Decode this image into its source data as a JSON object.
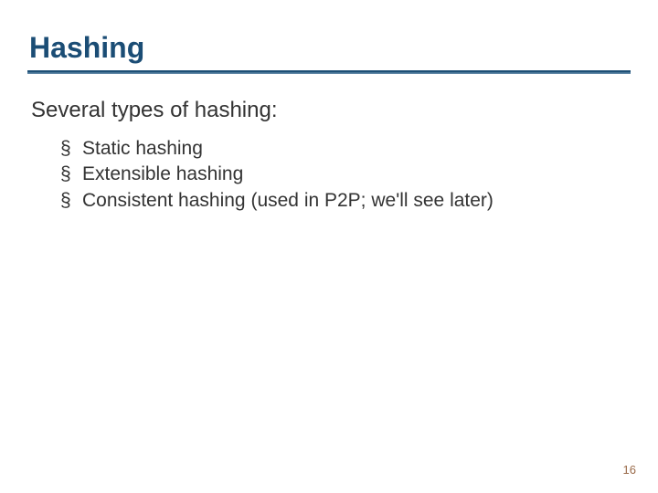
{
  "slide": {
    "title": "Hashing",
    "intro": "Several types of hashing:",
    "bullets": [
      "Static hashing",
      "Extensible hashing",
      "Consistent hashing (used in P2P; we'll see later)"
    ],
    "page_number": "16"
  }
}
